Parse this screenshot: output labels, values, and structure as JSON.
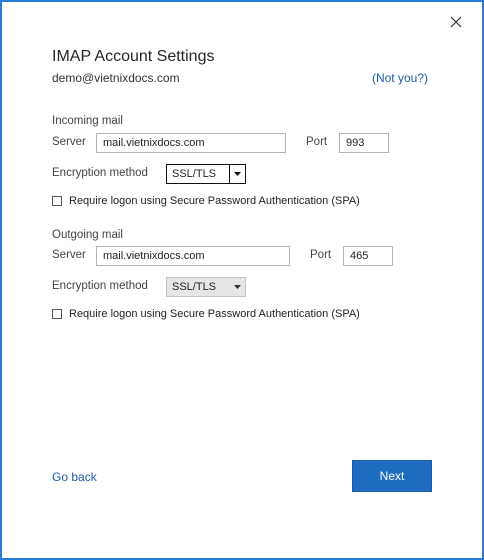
{
  "dialog": {
    "title": "IMAP Account Settings",
    "email": "demo@vietnixdocs.com",
    "not_you": "(Not you?)"
  },
  "incoming": {
    "section": "Incoming mail",
    "server_label": "Server",
    "server_value": "mail.vietnixdocs.com",
    "port_label": "Port",
    "port_value": "993",
    "encryption_label": "Encryption method",
    "encryption_value": "SSL/TLS",
    "spa_label": "Require logon using Secure Password Authentication (SPA)",
    "spa_checked": false
  },
  "outgoing": {
    "section": "Outgoing mail",
    "server_label": "Server",
    "server_value": "mail.vietnixdocs.com",
    "port_label": "Port",
    "port_value": "465",
    "encryption_label": "Encryption method",
    "encryption_value": "SSL/TLS",
    "spa_label": "Require logon using Secure Password Authentication (SPA)",
    "spa_checked": false
  },
  "footer": {
    "go_back": "Go back",
    "next": "Next"
  },
  "icons": {
    "close": "close-icon",
    "dropdown": "chevron-down-icon"
  },
  "colors": {
    "window_border": "#2b79d9",
    "link": "#1e5aa8",
    "primary_button": "#1f6dc2"
  }
}
